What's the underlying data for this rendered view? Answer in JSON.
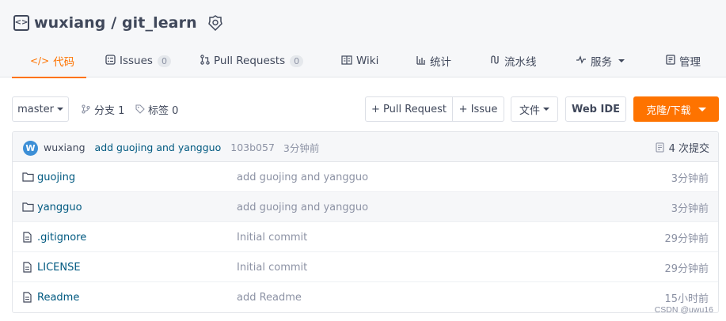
{
  "repo": {
    "owner": "wuxiang",
    "separator": " / ",
    "name": "git_learn",
    "repo_icon": "repo-code-icon",
    "badge_icon": "gvp-badge-icon"
  },
  "tabs": [
    {
      "label": "代码",
      "icon": "code-icon",
      "active": true
    },
    {
      "label": "Issues",
      "icon": "issues-icon",
      "count": "0"
    },
    {
      "label": "Pull Requests",
      "icon": "pull-request-icon",
      "count": "0"
    },
    {
      "label": "Wiki",
      "icon": "wiki-icon"
    },
    {
      "label": "统计",
      "icon": "stats-icon"
    },
    {
      "label": "流水线",
      "icon": "pipeline-icon"
    },
    {
      "label": "服务",
      "icon": "service-icon"
    },
    {
      "label": "管理",
      "icon": "manage-icon"
    }
  ],
  "toolbar": {
    "branch_select": "master",
    "branches_label": "分支 1",
    "tags_label": "标签 0",
    "pull_request_button": "+ Pull Request",
    "issue_button": "+ Issue",
    "file_button": "文件",
    "web_ide_button": "Web IDE",
    "clone_button": "克隆/下载"
  },
  "commit": {
    "avatar_letter": "W",
    "author": "wuxiang",
    "message": "add guojing and yangguo",
    "hash": "103b057",
    "time": "3分钟前",
    "count_label": "4 次提交"
  },
  "files": [
    {
      "type": "folder",
      "name": "guojing",
      "message": "add guojing and yangguo",
      "time": "3分钟前"
    },
    {
      "type": "folder",
      "name": "yangguo",
      "message": "add guojing and yangguo",
      "time": "3分钟前"
    },
    {
      "type": "file",
      "name": ".gitignore",
      "message": "Initial commit",
      "time": "29分钟前"
    },
    {
      "type": "file",
      "name": "LICENSE",
      "message": "Initial commit",
      "time": "29分钟前"
    },
    {
      "type": "file",
      "name": "Readme",
      "message": "add Readme",
      "time": "15小时前"
    }
  ],
  "watermark": "CSDN @uwu16",
  "colors": {
    "accent": "#fe7300",
    "link": "#005980",
    "muted": "#8c92a4",
    "text": "#40485b"
  }
}
